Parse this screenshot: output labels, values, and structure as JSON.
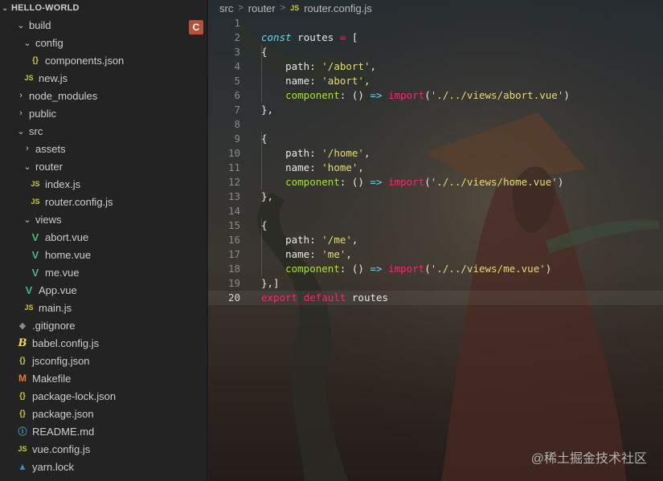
{
  "explorer": {
    "title": "HELLO-WORLD",
    "badge": "C",
    "items": [
      {
        "label": "build",
        "kind": "folder",
        "expanded": true,
        "depth": 1
      },
      {
        "label": "config",
        "kind": "folder",
        "expanded": true,
        "depth": 2
      },
      {
        "label": "components.json",
        "kind": "json",
        "icon_text": "{}",
        "depth": 3
      },
      {
        "label": "new.js",
        "kind": "js",
        "icon_text": "JS",
        "depth": 2
      },
      {
        "label": "node_modules",
        "kind": "folder",
        "expanded": false,
        "depth": 1
      },
      {
        "label": "public",
        "kind": "folder",
        "expanded": false,
        "depth": 1
      },
      {
        "label": "src",
        "kind": "folder",
        "expanded": true,
        "depth": 1
      },
      {
        "label": "assets",
        "kind": "folder",
        "expanded": false,
        "depth": 2
      },
      {
        "label": "router",
        "kind": "folder",
        "expanded": true,
        "depth": 2
      },
      {
        "label": "index.js",
        "kind": "js",
        "icon_text": "JS",
        "depth": 3
      },
      {
        "label": "router.config.js",
        "kind": "js",
        "icon_text": "JS",
        "depth": 3
      },
      {
        "label": "views",
        "kind": "folder",
        "expanded": true,
        "depth": 2
      },
      {
        "label": "abort.vue",
        "kind": "vue",
        "icon_text": "V",
        "depth": 3
      },
      {
        "label": "home.vue",
        "kind": "vue",
        "icon_text": "V",
        "depth": 3
      },
      {
        "label": "me.vue",
        "kind": "vue",
        "icon_text": "V",
        "depth": 3
      },
      {
        "label": "App.vue",
        "kind": "vue",
        "icon_text": "V",
        "depth": 2
      },
      {
        "label": "main.js",
        "kind": "js",
        "icon_text": "JS",
        "depth": 2
      },
      {
        "label": ".gitignore",
        "kind": "git",
        "icon_text": "◆",
        "depth": 1
      },
      {
        "label": "babel.config.js",
        "kind": "babel",
        "icon_text": "B",
        "depth": 1
      },
      {
        "label": "jsconfig.json",
        "kind": "json",
        "icon_text": "{}",
        "depth": 1
      },
      {
        "label": "Makefile",
        "kind": "make",
        "icon_text": "M",
        "depth": 1
      },
      {
        "label": "package-lock.json",
        "kind": "json",
        "icon_text": "{}",
        "depth": 1
      },
      {
        "label": "package.json",
        "kind": "json",
        "icon_text": "{}",
        "depth": 1
      },
      {
        "label": "README.md",
        "kind": "md",
        "icon_text": "ⓘ",
        "depth": 1
      },
      {
        "label": "vue.config.js",
        "kind": "js",
        "icon_text": "JS",
        "depth": 1
      },
      {
        "label": "yarn.lock",
        "kind": "yarn",
        "icon_text": "▲",
        "depth": 1
      }
    ]
  },
  "breadcrumb": {
    "parts": [
      "src",
      "router"
    ],
    "file_icon": "JS",
    "file": "router.config.js"
  },
  "editor": {
    "current_line": 20,
    "lines": [
      {
        "n": "1",
        "tokens": []
      },
      {
        "n": "2",
        "tokens": [
          [
            "k-italic",
            "const"
          ],
          [
            "t-white",
            " routes "
          ],
          [
            "k-red",
            "="
          ],
          [
            "t-white",
            " ["
          ]
        ]
      },
      {
        "n": "3",
        "tokens": [
          [
            "t-white",
            "{"
          ]
        ]
      },
      {
        "n": "4",
        "tokens": [
          [
            "t-white",
            "    path: "
          ],
          [
            "t-str",
            "'/abort'"
          ],
          [
            "t-white",
            ","
          ]
        ]
      },
      {
        "n": "5",
        "tokens": [
          [
            "t-white",
            "    name: "
          ],
          [
            "t-str",
            "'abort'"
          ],
          [
            "t-white",
            ","
          ]
        ]
      },
      {
        "n": "6",
        "tokens": [
          [
            "t-green",
            "    component"
          ],
          [
            "t-white",
            ": () "
          ],
          [
            "t-cyan",
            "=>"
          ],
          [
            "t-white",
            " "
          ],
          [
            "k-red",
            "import"
          ],
          [
            "t-white",
            "("
          ],
          [
            "t-str",
            "'./../views/abort.vue'"
          ],
          [
            "t-white",
            ")"
          ]
        ]
      },
      {
        "n": "7",
        "tokens": [
          [
            "t-white",
            "},"
          ]
        ]
      },
      {
        "n": "8",
        "tokens": []
      },
      {
        "n": "9",
        "tokens": [
          [
            "t-white",
            "{"
          ]
        ]
      },
      {
        "n": "10",
        "tokens": [
          [
            "t-white",
            "    path: "
          ],
          [
            "t-str",
            "'/home'"
          ],
          [
            "t-white",
            ","
          ]
        ]
      },
      {
        "n": "11",
        "tokens": [
          [
            "t-white",
            "    name: "
          ],
          [
            "t-str",
            "'home'"
          ],
          [
            "t-white",
            ","
          ]
        ]
      },
      {
        "n": "12",
        "tokens": [
          [
            "t-green",
            "    component"
          ],
          [
            "t-white",
            ": () "
          ],
          [
            "t-cyan",
            "=>"
          ],
          [
            "t-white",
            " "
          ],
          [
            "k-red",
            "import"
          ],
          [
            "t-white",
            "("
          ],
          [
            "t-str",
            "'./../views/home.vue'"
          ],
          [
            "t-white",
            ")"
          ]
        ]
      },
      {
        "n": "13",
        "tokens": [
          [
            "t-white",
            "},"
          ]
        ]
      },
      {
        "n": "14",
        "tokens": []
      },
      {
        "n": "15",
        "tokens": [
          [
            "t-white",
            "{"
          ]
        ]
      },
      {
        "n": "16",
        "tokens": [
          [
            "t-white",
            "    path: "
          ],
          [
            "t-str",
            "'/me'"
          ],
          [
            "t-white",
            ","
          ]
        ]
      },
      {
        "n": "17",
        "tokens": [
          [
            "t-white",
            "    name: "
          ],
          [
            "t-str",
            "'me'"
          ],
          [
            "t-white",
            ","
          ]
        ]
      },
      {
        "n": "18",
        "tokens": [
          [
            "t-green",
            "    component"
          ],
          [
            "t-white",
            ": () "
          ],
          [
            "t-cyan",
            "=>"
          ],
          [
            "t-white",
            " "
          ],
          [
            "k-red",
            "import"
          ],
          [
            "t-white",
            "("
          ],
          [
            "t-str",
            "'./../views/me.vue'"
          ],
          [
            "t-white",
            ")"
          ]
        ]
      },
      {
        "n": "19",
        "tokens": [
          [
            "t-white",
            "},]"
          ]
        ]
      },
      {
        "n": "20",
        "tokens": [
          [
            "k-red",
            "export"
          ],
          [
            "t-white",
            " "
          ],
          [
            "k-red",
            "default"
          ],
          [
            "t-white",
            " routes"
          ]
        ]
      }
    ]
  },
  "watermark": "@稀土掘金技术社区",
  "colors": {
    "sidebar_bg": "#232323",
    "badge_bg": "#b6513a",
    "keyword": "#f92672",
    "string": "#e6db74",
    "function": "#a6e22e",
    "storage": "#66d9ef"
  }
}
